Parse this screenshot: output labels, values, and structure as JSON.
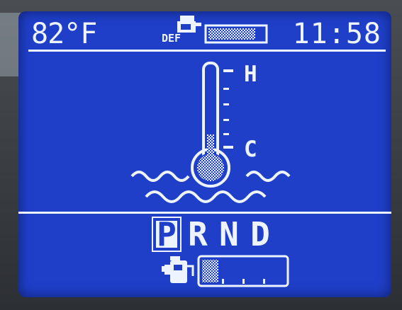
{
  "status_bar": {
    "outside_temperature": "82°F",
    "def_label": "DEF",
    "def_level_fraction": 0.85,
    "time": "11:58"
  },
  "coolant_gauge": {
    "icon": "engine-coolant-temperature-icon",
    "hot_label": "H",
    "cold_label": "C",
    "level_fraction": 0.25
  },
  "transmission": {
    "gears": [
      "P",
      "R",
      "N",
      "D"
    ],
    "selected": "P"
  },
  "fuel": {
    "icon": "fuel-pump-icon",
    "level_fraction": 0.2,
    "segments": 4
  },
  "colors": {
    "screen": "#1f3fc9",
    "segment": "#eef4ff"
  }
}
